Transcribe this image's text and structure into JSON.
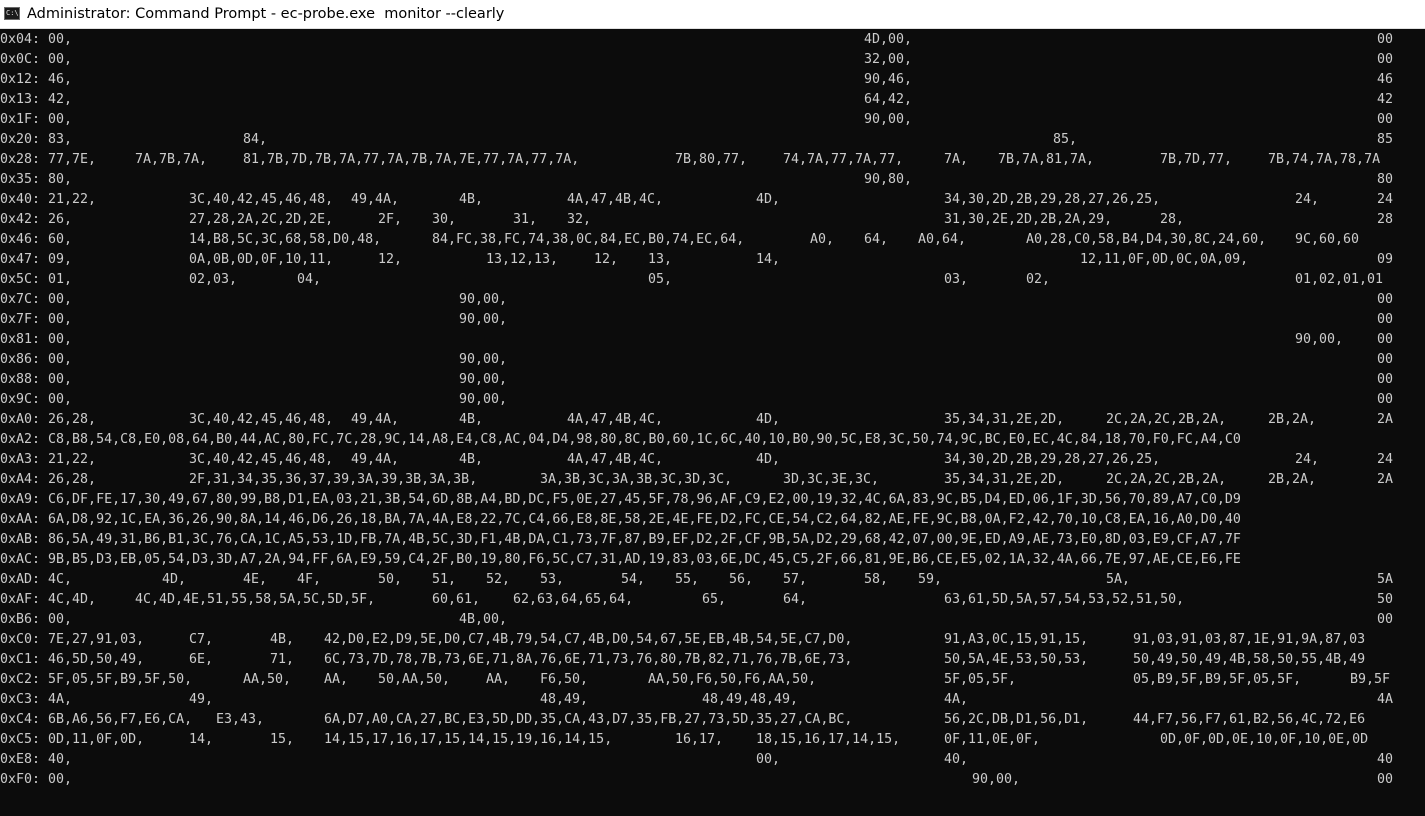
{
  "window": {
    "icon_text": "C:\\",
    "title": "Administrator: Command Prompt - ec-probe.exe  monitor --clearly"
  },
  "colors": {
    "console_background": "#0c0c0c",
    "console_text": "#cccccc",
    "titlebar_background": "#ffffff"
  },
  "console_rows": [
    {
      "cells": [
        "0x04: 00,",
        "4D,00,",
        "00"
      ]
    },
    {
      "cells": [
        "0x0C: 00,",
        "32,00,",
        "00"
      ]
    },
    {
      "cells": [
        "0x12: 46,",
        "90,46,",
        "46"
      ]
    },
    {
      "cells": [
        "0x13: 42,",
        "64,42,",
        "42"
      ]
    },
    {
      "cells": [
        "0x1F: 00,",
        "90,00,",
        "00"
      ]
    },
    {
      "cells": [
        "0x20: 83,",
        "84,",
        "85,",
        "85"
      ]
    },
    {
      "cells": [
        "0x28: 77,7E,",
        "7A,7B,7A,",
        "81,7B,7D,7B,7A,77,7A,7B,7A,7E,77,7A,77,7A,",
        "7B,80,77,",
        "74,7A,77,7A,77,",
        "7A,",
        "7B,7A,81,7A,",
        "7B,7D,77,",
        "7B,74,7A,78,7A"
      ]
    },
    {
      "cells": [
        "0x35: 80,",
        "90,80,",
        "80"
      ]
    },
    {
      "cells": [
        "0x40: 21,22,",
        "3C,40,42,45,46,48,",
        "49,4A,",
        "4B,",
        "4A,47,4B,4C,",
        "4D,",
        "34,30,2D,2B,29,28,27,26,25,",
        "24,",
        "24"
      ]
    },
    {
      "cells": [
        "0x42: 26,",
        "27,28,2A,2C,2D,2E,",
        "2F,",
        "30,",
        "31,",
        "32,",
        "31,30,2E,2D,2B,2A,29,",
        "28,",
        "28"
      ]
    },
    {
      "cells": [
        "0x46: 60,",
        "14,B8,5C,3C,68,58,D0,48,",
        "84,FC,38,FC,74,38,0C,84,EC,B0,74,EC,64,",
        "A0,",
        "64,",
        "A0,64,",
        "A0,28,C0,58,B4,D4,30,8C,24,60,",
        "9C,60,60"
      ]
    },
    {
      "cells": [
        "0x47: 09,",
        "0A,0B,0D,0F,10,11,",
        "12,",
        "13,12,13,",
        "12,",
        "13,",
        "14,",
        "12,11,0F,0D,0C,0A,09,",
        "09"
      ]
    },
    {
      "cells": [
        "0x5C: 01,",
        "02,03,",
        "04,",
        "05,",
        "03,",
        "02,",
        "01,02,01,01"
      ]
    },
    {
      "cells": [
        "0x7C: 00,",
        "90,00,",
        "00"
      ]
    },
    {
      "cells": [
        "0x7F: 00,",
        "90,00,",
        "00"
      ]
    },
    {
      "cells": [
        "0x81: 00,",
        "90,00,",
        "00"
      ]
    },
    {
      "cells": [
        "0x86: 00,",
        "90,00,",
        "00"
      ]
    },
    {
      "cells": [
        "0x88: 00,",
        "90,00,",
        "00"
      ]
    },
    {
      "cells": [
        "0x9C: 00,",
        "90,00,",
        "00"
      ]
    },
    {
      "cells": [
        "0xA0: 26,28,",
        "3C,40,42,45,46,48,",
        "49,4A,",
        "4B,",
        "4A,47,4B,4C,",
        "4D,",
        "35,34,31,2E,2D,",
        "2C,2A,2C,2B,2A,",
        "2B,2A,",
        "2A"
      ]
    },
    {
      "cells": [
        "0xA2: C8,B8,54,C8,E0,08,64,B0,44,AC,80,FC,7C,28,9C,14,A8,E4,C8,AC,04,D4,98,80,8C,B0,60,1C,6C,40,10,B0,90,5C,E8,3C,50,74,9C,BC,E0,EC,4C,84,18,70,F0,FC,A4,C0"
      ]
    },
    {
      "cells": [
        "0xA3: 21,22,",
        "3C,40,42,45,46,48,",
        "49,4A,",
        "4B,",
        "4A,47,4B,4C,",
        "4D,",
        "34,30,2D,2B,29,28,27,26,25,",
        "24,",
        "24"
      ]
    },
    {
      "cells": [
        "0xA4: 26,28,",
        "2F,31,34,35,36,37,39,3A,39,3B,3A,3B,",
        "3A,3B,3C,3A,3B,3C,3D,3C,",
        "3D,3C,3E,3C,",
        "35,34,31,2E,2D,",
        "2C,2A,2C,2B,2A,",
        "2B,2A,",
        "2A"
      ]
    },
    {
      "cells": [
        "0xA9: C6,DF,FE,17,30,49,67,80,99,B8,D1,EA,03,21,3B,54,6D,8B,A4,BD,DC,F5,0E,27,45,5F,78,96,AF,C9,E2,00,19,32,4C,6A,83,9C,B5,D4,ED,06,1F,3D,56,70,89,A7,C0,D9"
      ]
    },
    {
      "cells": [
        "0xAA: 6A,D8,92,1C,EA,36,26,90,8A,14,46,D6,26,18,BA,7A,4A,E8,22,7C,C4,66,E8,8E,58,2E,4E,FE,D2,FC,CE,54,C2,64,82,AE,FE,9C,B8,0A,F2,42,70,10,C8,EA,16,A0,D0,40"
      ]
    },
    {
      "cells": [
        "0xAB: 86,5A,49,31,B6,B1,3C,76,CA,1C,A5,53,1D,FB,7A,4B,5C,3D,F1,4B,DA,C1,73,7F,87,B9,EF,D2,2F,CF,9B,5A,D2,29,68,42,07,00,9E,ED,A9,AE,73,E0,8D,03,E9,CF,A7,7F"
      ]
    },
    {
      "cells": [
        "0xAC: 9B,B5,D3,EB,05,54,D3,3D,A7,2A,94,FF,6A,E9,59,C4,2F,B0,19,80,F6,5C,C7,31,AD,19,83,03,6E,DC,45,C5,2F,66,81,9E,B6,CE,E5,02,1A,32,4A,66,7E,97,AE,CE,E6,FE"
      ]
    },
    {
      "cells": [
        "0xAD: 4C,",
        "4D,",
        "4E,",
        "4F,",
        "50,",
        "51,",
        "52,",
        "53,",
        "54,",
        "55,",
        "56,",
        "57,",
        "58,",
        "59,",
        "5A,",
        "5A"
      ]
    },
    {
      "cells": [
        "0xAF: 4C,4D,",
        "4C,4D,4E,51,55,58,5A,5C,5D,5F,",
        "60,61,",
        "62,63,64,65,64,",
        "65,",
        "64,",
        "63,61,5D,5A,57,54,53,52,51,50,",
        "50"
      ]
    },
    {
      "cells": [
        "0xB6: 00,",
        "4B,00,",
        "00"
      ]
    },
    {
      "cells": [
        "0xC0: 7E,27,91,03,",
        "C7,",
        "4B,",
        "42,D0,E2,D9,5E,D0,C7,4B,79,54,C7,4B,D0,54,67,5E,EB,4B,54,5E,C7,D0,",
        "91,A3,0C,15,91,15,",
        "91,03,91,03,87,1E,91,9A,87,03"
      ]
    },
    {
      "cells": [
        "0xC1: 46,5D,50,49,",
        "6E,",
        "71,",
        "6C,73,7D,78,7B,73,6E,71,8A,76,6E,71,73,76,80,7B,82,71,76,7B,6E,73,",
        "50,5A,4E,53,50,53,",
        "50,49,50,49,4B,58,50,55,4B,49"
      ]
    },
    {
      "cells": [
        "0xC2: 5F,05,5F,B9,5F,50,",
        "AA,50,",
        "AA,",
        "50,AA,50,",
        "AA,",
        "F6,50,",
        "AA,50,F6,50,F6,AA,50,",
        "5F,05,5F,",
        "05,B9,5F,B9,5F,05,5F,",
        "B9,5F"
      ]
    },
    {
      "cells": [
        "0xC3: 4A,",
        "49,",
        "48,49,",
        "48,49,48,49,",
        "4A,",
        "4A"
      ]
    },
    {
      "cells": [
        "0xC4: 6B,A6,56,F7,E6,CA,",
        "E3,43,",
        "6A,D7,A0,CA,27,BC,E3,5D,DD,35,CA,43,D7,35,FB,27,73,5D,35,27,CA,BC,",
        "56,2C,DB,D1,56,D1,",
        "44,F7,56,F7,61,B2,56,4C,72,E6"
      ]
    },
    {
      "cells": [
        "0xC5: 0D,11,0F,0D,",
        "14,",
        "15,",
        "14,15,17,16,17,15,14,15,19,16,14,15,",
        "16,17,",
        "18,15,16,17,14,15,",
        "0F,11,0E,0F,",
        "0D,0F,0D,0E,10,0F,10,0E,0D"
      ]
    },
    {
      "cells": [
        "0xE8: 40,",
        "00,",
        "40,",
        "40"
      ]
    },
    {
      "cells": [
        "0xF0: 00,",
        "90,00,",
        "00"
      ]
    }
  ]
}
